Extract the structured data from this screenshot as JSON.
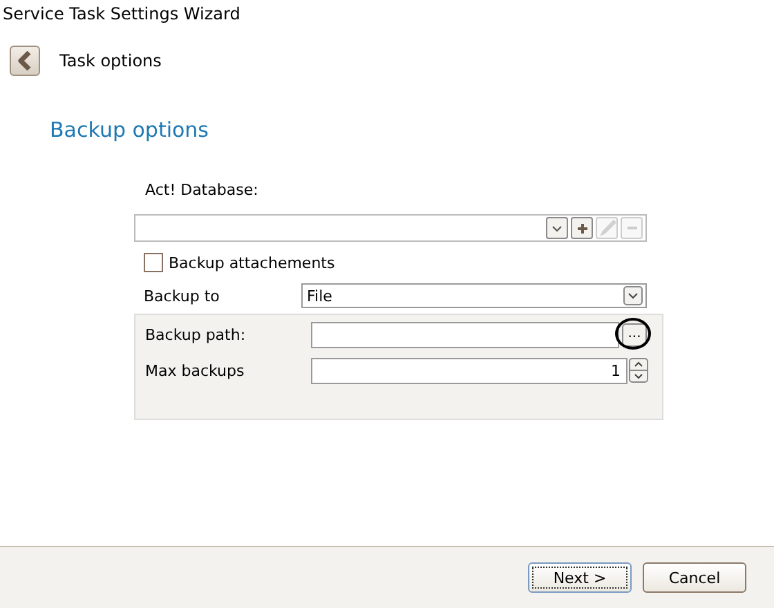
{
  "window": {
    "title": "Service Task Settings Wizard"
  },
  "header": {
    "step": "Task options"
  },
  "section_title": "Backup options",
  "database": {
    "label": "Act! Database:",
    "value_buttons": {
      "edit_disabled": true,
      "remove_disabled": true
    }
  },
  "backup_attachments": {
    "label": "Backup attachements",
    "checked": false
  },
  "backup_to": {
    "label": "Backup to",
    "value": "File"
  },
  "backup_path": {
    "label": "Backup path:",
    "browse": "...",
    "highlighted": true
  },
  "max_backups": {
    "label": "Max backups",
    "value": "1"
  },
  "buttons": [
    {
      "label": "Next >",
      "focused": true
    },
    {
      "label": "Cancel",
      "focused": false
    }
  ]
}
